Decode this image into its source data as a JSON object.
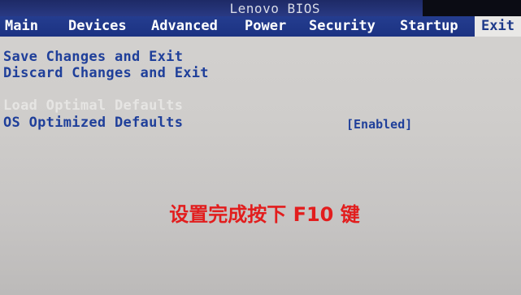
{
  "header": {
    "title": "Lenovo BIOS"
  },
  "tabs": [
    {
      "label": "Main"
    },
    {
      "label": "Devices"
    },
    {
      "label": "Advanced"
    },
    {
      "label": "Power"
    },
    {
      "label": "Security"
    },
    {
      "label": "Startup"
    },
    {
      "label": "Exit",
      "active": true
    }
  ],
  "menu": {
    "items": [
      {
        "label": "Save Changes and Exit"
      },
      {
        "label": "Discard Changes and Exit"
      },
      {
        "label": "Load Optimal Defaults",
        "disabled": true
      },
      {
        "label": "OS Optimized Defaults",
        "value": "[Enabled]"
      }
    ]
  },
  "overlay": {
    "caption": "设置完成按下 F10 键"
  },
  "colors": {
    "tab_bar": "#1c3282",
    "menu_text": "#1f3f9a",
    "caption": "#e21d1d",
    "background": "#cfcdcb"
  }
}
